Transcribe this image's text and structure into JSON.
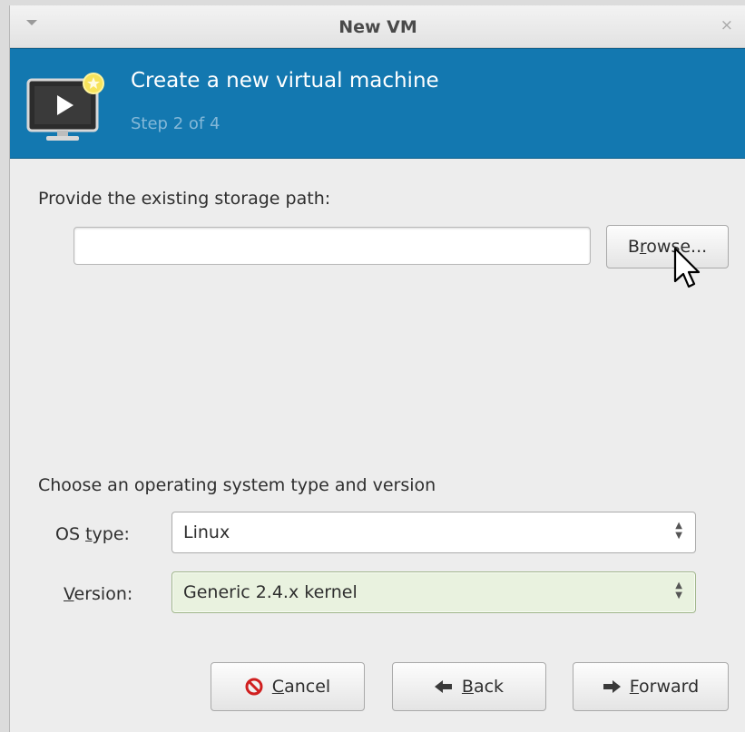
{
  "window": {
    "title": "New VM",
    "close_glyph": "×"
  },
  "banner": {
    "title": "Create a new virtual machine",
    "subtitle": "Step 2 of 4",
    "icon": "monitor-new-icon"
  },
  "storage": {
    "label": "Provide the existing storage path:",
    "path_value": "",
    "browse": {
      "pre": "B",
      "mnemonic": "r",
      "post": "owse..."
    }
  },
  "os": {
    "heading": "Choose an operating system type and version",
    "type_label": {
      "pre": "OS ",
      "mnemonic": "t",
      "post": "ype:"
    },
    "type_value": "Linux",
    "version_label": {
      "pre": "",
      "mnemonic": "V",
      "post": "ersion:"
    },
    "version_value": "Generic 2.4.x kernel"
  },
  "buttons": {
    "cancel": {
      "mnemonic": "C",
      "post": "ancel"
    },
    "back": {
      "mnemonic": "B",
      "post": "ack"
    },
    "forward": {
      "mnemonic": "F",
      "post": "orward"
    }
  },
  "colors": {
    "banner": "#1378b0",
    "banner_subtitle": "#84b8d8",
    "version_selected_bg": "#e9f2df",
    "cancel_icon": "#d01f1f"
  }
}
